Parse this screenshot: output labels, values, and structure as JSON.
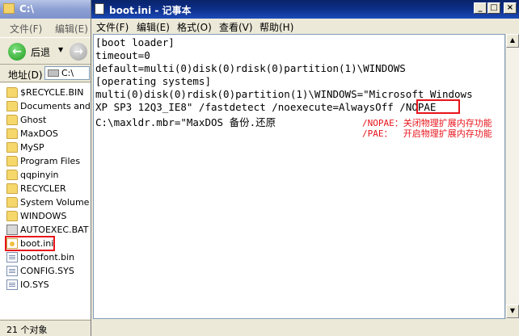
{
  "explorer": {
    "title": "C:\\",
    "menu": {
      "file": "文件(F)",
      "edit": "编辑(E)"
    },
    "toolbar": {
      "back_label": "后退",
      "back_arrow": "←",
      "forward_arrow": "→",
      "drop": "▼"
    },
    "address": {
      "label": "地址(D)",
      "value": "C:\\"
    },
    "files": [
      {
        "name": "$RECYCLE.BIN",
        "icon": "folder-icon"
      },
      {
        "name": "Documents and S",
        "icon": "folder-icon"
      },
      {
        "name": "Ghost",
        "icon": "folder-icon"
      },
      {
        "name": "MaxDOS",
        "icon": "folder-icon"
      },
      {
        "name": "MySP",
        "icon": "folder-icon"
      },
      {
        "name": "Program Files",
        "icon": "folder-icon"
      },
      {
        "name": "qqpinyin",
        "icon": "folder-icon"
      },
      {
        "name": "RECYCLER",
        "icon": "folder-icon"
      },
      {
        "name": "System Volume In",
        "icon": "folder-icon"
      },
      {
        "name": "WINDOWS",
        "icon": "folder-icon"
      },
      {
        "name": "AUTOEXEC.BAT",
        "icon": "batch-file-icon"
      },
      {
        "name": "boot.ini",
        "icon": "ini-file-icon"
      },
      {
        "name": "bootfont.bin",
        "icon": "file-icon"
      },
      {
        "name": "CONFIG.SYS",
        "icon": "file-icon"
      },
      {
        "name": "IO.SYS",
        "icon": "file-icon"
      }
    ],
    "status": "21 个对象"
  },
  "notepad": {
    "title": "boot.ini - 记事本",
    "buttons": {
      "minimize": "_",
      "maximize": "□",
      "close": "×"
    },
    "menu": [
      "文件(F)",
      "编辑(E)",
      "格式(O)",
      "查看(V)",
      "帮助(H)"
    ],
    "lines": [
      "[boot loader]",
      "timeout=0",
      "default=multi(0)disk(0)rdisk(0)partition(1)\\WINDOWS",
      "[operating systems]",
      "multi(0)disk(0)rdisk(0)partition(1)\\WINDOWS=\"Microsoft Windows",
      "XP SP3 12Q3_IE8\" /fastdetect /noexecute=AlwaysOff ",
      "C:\\maxldr.mbr=\"MaxDOS 备份.还原"
    ],
    "highlight_token": "/NOPAE",
    "notes": [
      "/NOPAE：关闭物理扩展内存功能",
      "/PAE：  开启物理扩展内存功能"
    ],
    "scroll": {
      "up": "▲",
      "down": "▼"
    }
  },
  "colors": {
    "annotation_red": "#e8141b",
    "title_blue": "#0a246a"
  }
}
